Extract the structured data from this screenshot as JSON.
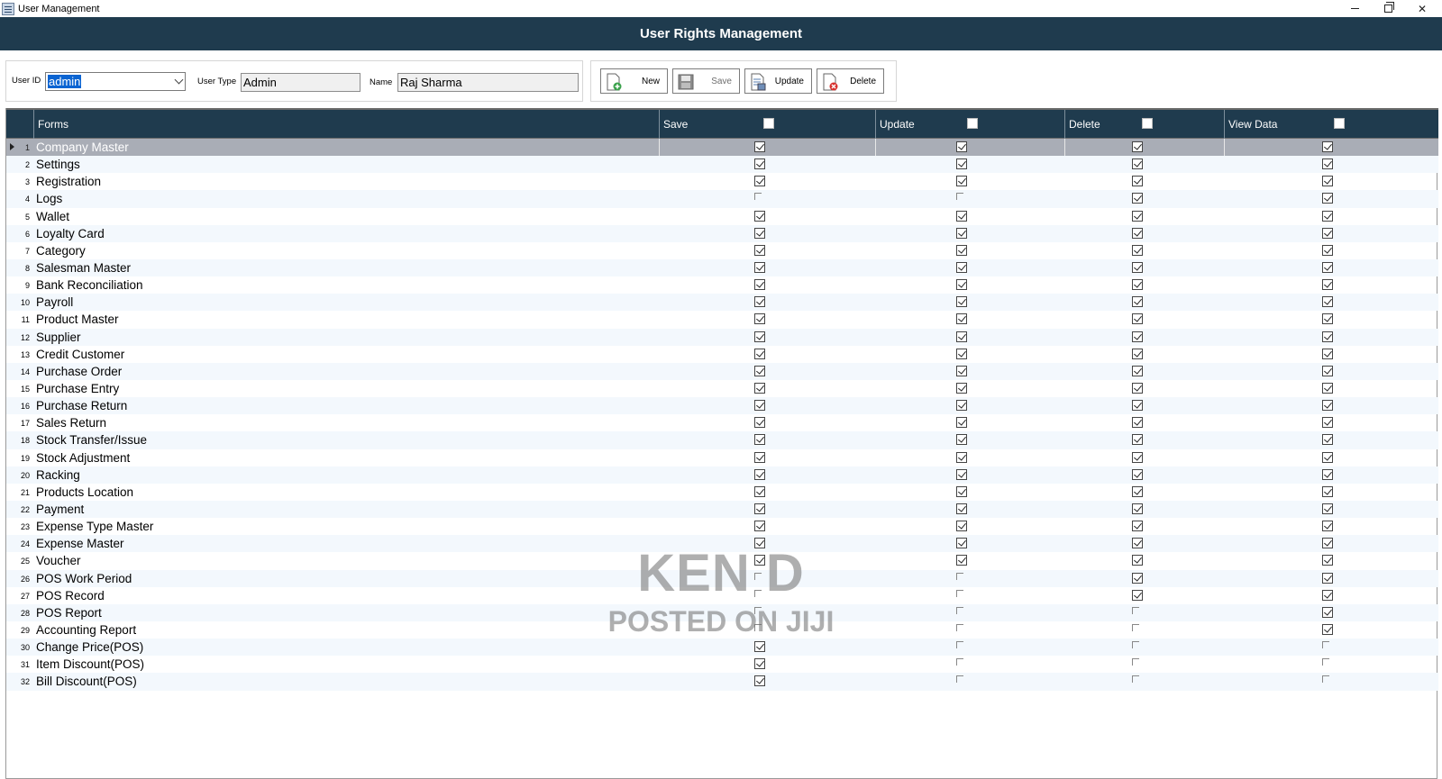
{
  "window": {
    "title": "User Management"
  },
  "header": {
    "title": "User Rights Management"
  },
  "filters": {
    "user_id_label": "User ID",
    "user_id_value": "admin",
    "user_type_label": "User Type",
    "user_type_value": "Admin",
    "name_label": "Name",
    "name_value": "Raj Sharma"
  },
  "toolbar": {
    "new_label": "New",
    "save_label": "Save",
    "update_label": "Update",
    "delete_label": "Delete"
  },
  "grid": {
    "columns": [
      "Forms",
      "Save",
      "Update",
      "Delete",
      "View Data"
    ],
    "rows": [
      {
        "n": "1",
        "form": "Company Master",
        "save": true,
        "update": true,
        "delete": true,
        "view": true
      },
      {
        "n": "2",
        "form": "Settings",
        "save": true,
        "update": true,
        "delete": true,
        "view": true
      },
      {
        "n": "3",
        "form": "Registration",
        "save": true,
        "update": true,
        "delete": true,
        "view": true
      },
      {
        "n": "4",
        "form": "Logs",
        "save": false,
        "update": false,
        "delete": true,
        "view": true
      },
      {
        "n": "5",
        "form": "Wallet",
        "save": true,
        "update": true,
        "delete": true,
        "view": true
      },
      {
        "n": "6",
        "form": "Loyalty Card",
        "save": true,
        "update": true,
        "delete": true,
        "view": true
      },
      {
        "n": "7",
        "form": "Category",
        "save": true,
        "update": true,
        "delete": true,
        "view": true
      },
      {
        "n": "8",
        "form": "Salesman Master",
        "save": true,
        "update": true,
        "delete": true,
        "view": true
      },
      {
        "n": "9",
        "form": "Bank Reconciliation",
        "save": true,
        "update": true,
        "delete": true,
        "view": true
      },
      {
        "n": "10",
        "form": "Payroll",
        "save": true,
        "update": true,
        "delete": true,
        "view": true
      },
      {
        "n": "11",
        "form": "Product Master",
        "save": true,
        "update": true,
        "delete": true,
        "view": true
      },
      {
        "n": "12",
        "form": "Supplier",
        "save": true,
        "update": true,
        "delete": true,
        "view": true
      },
      {
        "n": "13",
        "form": "Credit Customer",
        "save": true,
        "update": true,
        "delete": true,
        "view": true
      },
      {
        "n": "14",
        "form": "Purchase Order",
        "save": true,
        "update": true,
        "delete": true,
        "view": true
      },
      {
        "n": "15",
        "form": "Purchase Entry",
        "save": true,
        "update": true,
        "delete": true,
        "view": true
      },
      {
        "n": "16",
        "form": "Purchase Return",
        "save": true,
        "update": true,
        "delete": true,
        "view": true
      },
      {
        "n": "17",
        "form": "Sales Return",
        "save": true,
        "update": true,
        "delete": true,
        "view": true
      },
      {
        "n": "18",
        "form": "Stock Transfer/Issue",
        "save": true,
        "update": true,
        "delete": true,
        "view": true
      },
      {
        "n": "19",
        "form": "Stock Adjustment",
        "save": true,
        "update": true,
        "delete": true,
        "view": true
      },
      {
        "n": "20",
        "form": "Racking",
        "save": true,
        "update": true,
        "delete": true,
        "view": true
      },
      {
        "n": "21",
        "form": "Products Location",
        "save": true,
        "update": true,
        "delete": true,
        "view": true
      },
      {
        "n": "22",
        "form": "Payment",
        "save": true,
        "update": true,
        "delete": true,
        "view": true
      },
      {
        "n": "23",
        "form": "Expense Type Master",
        "save": true,
        "update": true,
        "delete": true,
        "view": true
      },
      {
        "n": "24",
        "form": "Expense Master",
        "save": true,
        "update": true,
        "delete": true,
        "view": true
      },
      {
        "n": "25",
        "form": "Voucher",
        "save": true,
        "update": true,
        "delete": true,
        "view": true
      },
      {
        "n": "26",
        "form": "POS Work Period",
        "save": false,
        "update": false,
        "delete": true,
        "view": true
      },
      {
        "n": "27",
        "form": "POS Record",
        "save": false,
        "update": false,
        "delete": true,
        "view": true
      },
      {
        "n": "28",
        "form": "POS Report",
        "save": false,
        "update": false,
        "delete": false,
        "view": true
      },
      {
        "n": "29",
        "form": "Accounting Report",
        "save": false,
        "update": false,
        "delete": false,
        "view": true
      },
      {
        "n": "30",
        "form": "Change Price(POS)",
        "save": true,
        "update": false,
        "delete": false,
        "view": false
      },
      {
        "n": "31",
        "form": "Item Discount(POS)",
        "save": true,
        "update": false,
        "delete": false,
        "view": false
      },
      {
        "n": "32",
        "form": "Bill Discount(POS)",
        "save": true,
        "update": false,
        "delete": false,
        "view": false
      }
    ]
  },
  "watermark": {
    "line1": "KEN D",
    "line2": "POSTED ON JIJI"
  }
}
